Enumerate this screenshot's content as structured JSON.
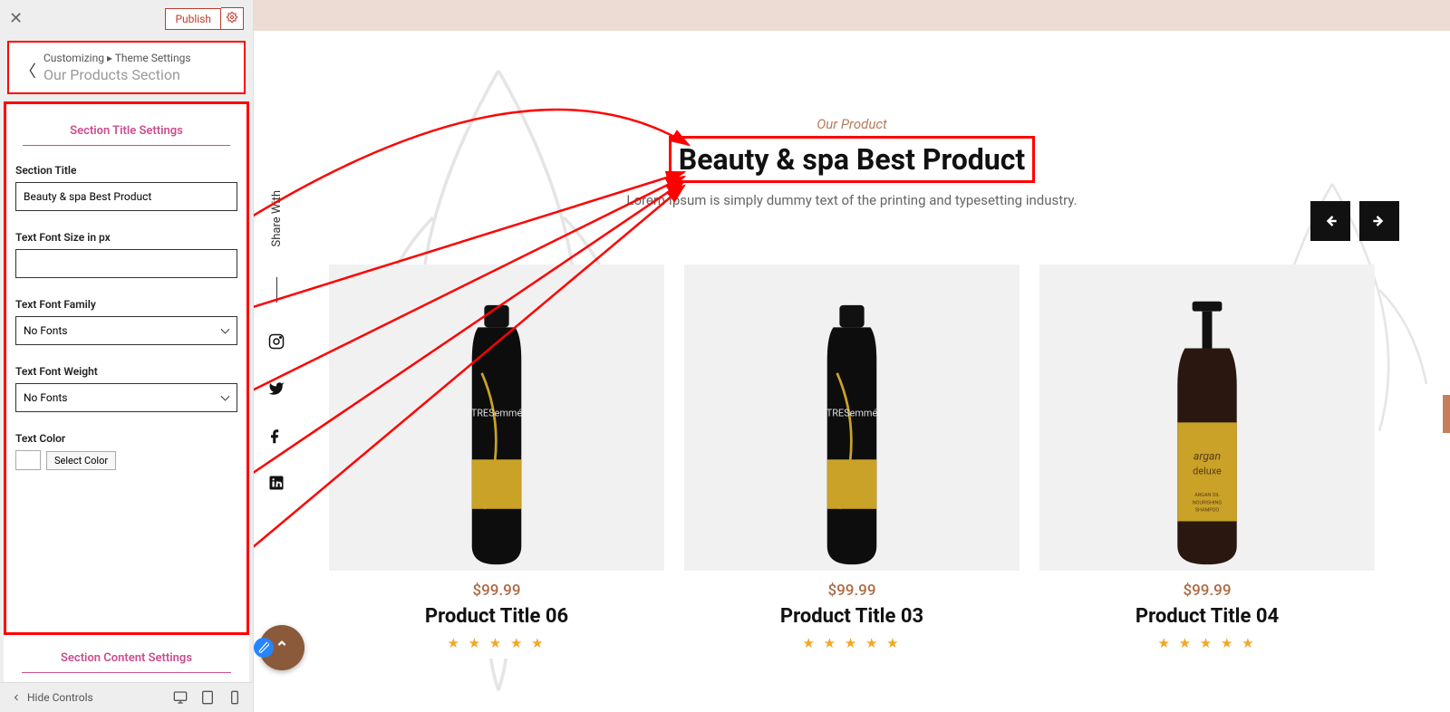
{
  "sidebar": {
    "publish_label": "Publish",
    "breadcrumb_prefix": "Customizing",
    "breadcrumb_parent": "Theme Settings",
    "breadcrumb_current": "Our Products Section",
    "section_title_settings": "Section Title Settings",
    "labels": {
      "section_title": "Section Title",
      "font_size": "Text Font Size in px",
      "font_family": "Text Font Family",
      "font_weight": "Text Font Weight",
      "text_color": "Text Color"
    },
    "values": {
      "section_title": "Beauty & spa Best Product",
      "font_size": "",
      "font_family": "No Fonts",
      "font_weight": "No Fonts"
    },
    "select_color_label": "Select Color",
    "section_content_settings": "Section Content Settings",
    "hide_controls": "Hide Controls"
  },
  "preview": {
    "share_label": "Share With",
    "eyebrow": "Our Product",
    "title": "Beauty & spa Best Product",
    "subtitle": "Lorem Ipsum is simply dummy text of the printing and typesetting industry.",
    "products": [
      {
        "price": "$99.99",
        "title": "Product Title 06"
      },
      {
        "price": "$99.99",
        "title": "Product Title 03"
      },
      {
        "price": "$99.99",
        "title": "Product Title 04"
      }
    ],
    "stars": "★ ★ ★ ★ ★"
  }
}
